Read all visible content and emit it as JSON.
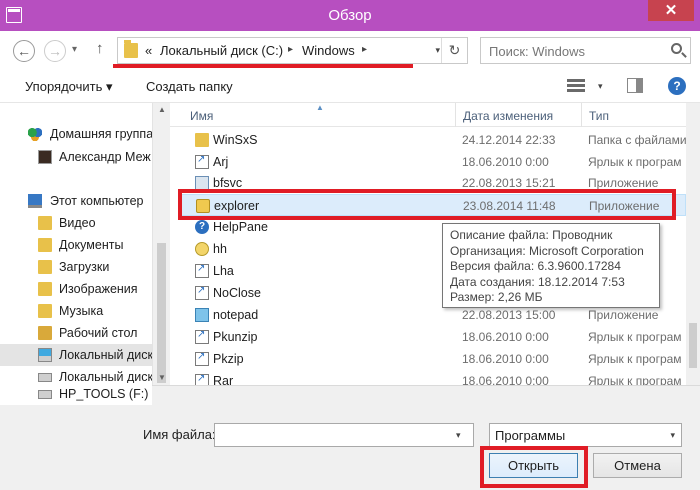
{
  "window": {
    "title": "Обзор",
    "close_glyph": "✕"
  },
  "nav": {
    "back_glyph": "←",
    "forward_glyph": "→",
    "recent_glyph": "▾",
    "up_glyph": "↑",
    "address": {
      "prefix": "«",
      "crumbs": [
        "Локальный диск (C:)",
        "Windows"
      ],
      "sep_glyph": "▸",
      "dropdown_glyph": "▾",
      "refresh_glyph": "↻"
    },
    "search": {
      "placeholder": "Поиск: Windows"
    }
  },
  "toolbar": {
    "organize_label": "Упорядочить ▾",
    "new_folder_label": "Создать папку",
    "view_dd_glyph": "▾",
    "help_glyph": "?"
  },
  "sidebar": {
    "items": [
      {
        "label": "Домашняя группа",
        "icon": "homegroup-icon"
      },
      {
        "label": "Александр Меж",
        "icon": "user-icon"
      },
      {
        "label": "Этот компьютер",
        "icon": "computer-icon"
      },
      {
        "label": "Видео",
        "icon": "folder-icon"
      },
      {
        "label": "Документы",
        "icon": "folder-icon"
      },
      {
        "label": "Загрузки",
        "icon": "folder-icon"
      },
      {
        "label": "Изображения",
        "icon": "folder-icon"
      },
      {
        "label": "Музыка",
        "icon": "folder-icon"
      },
      {
        "label": "Рабочий стол",
        "icon": "folder-icon"
      },
      {
        "label": "Локальный диск",
        "icon": "drive-icon"
      },
      {
        "label": "Локальный диск",
        "icon": "drive-icon"
      },
      {
        "label": "HP_TOOLS (F:)",
        "icon": "drive-icon"
      }
    ],
    "scroll_up_glyph": "▲",
    "scroll_down_glyph": "▼"
  },
  "columns": {
    "name": "Имя",
    "date": "Дата изменения",
    "type": "Тип",
    "sort_glyph": "▲"
  },
  "files": [
    {
      "name": "WinSxS",
      "date": "24.12.2014 22:33",
      "type": "Папка с файлами",
      "icon": "folder-icon"
    },
    {
      "name": "Arj",
      "date": "18.06.2010 0:00",
      "type": "Ярлык к програм",
      "icon": "shortcut-icon"
    },
    {
      "name": "bfsvc",
      "date": "22.08.2013 15:21",
      "type": "Приложение",
      "icon": "application-icon"
    },
    {
      "name": "explorer",
      "date": "23.08.2014 11:48",
      "type": "Приложение",
      "icon": "explorer-icon"
    },
    {
      "name": "HelpPane",
      "date": "",
      "type": "",
      "icon": "help-icon"
    },
    {
      "name": "hh",
      "date": "",
      "type": "",
      "icon": "hh-icon"
    },
    {
      "name": "Lha",
      "date": "",
      "type": "",
      "icon": "shortcut-icon"
    },
    {
      "name": "NoClose",
      "date": "",
      "type": "",
      "icon": "shortcut-icon"
    },
    {
      "name": "notepad",
      "date": "22.08.2013 15:00",
      "type": "Приложение",
      "icon": "notepad-icon"
    },
    {
      "name": "Pkunzip",
      "date": "18.06.2010 0:00",
      "type": "Ярлык к програм",
      "icon": "shortcut-icon"
    },
    {
      "name": "Pkzip",
      "date": "18.06.2010 0:00",
      "type": "Ярлык к програм",
      "icon": "shortcut-icon"
    },
    {
      "name": "Rar",
      "date": "18.06.2010 0:00",
      "type": "Ярлык к програм",
      "icon": "shortcut-icon"
    }
  ],
  "tooltip": {
    "lines": [
      "Описание файла: Проводник",
      "Организация: Microsoft Corporation",
      "Версия файла: 6.3.9600.17284",
      "Дата создания: 18.12.2014 7:53",
      "Размер: 2,26 МБ"
    ]
  },
  "footer": {
    "filename_label": "Имя файла:",
    "filename_value": "",
    "filename_dd_glyph": "▾",
    "filter_value": "Программы",
    "filter_dd_glyph": "▾",
    "open_label": "Открыть",
    "cancel_label": "Отмена"
  },
  "colors": {
    "titlebar": "#b74fc0",
    "highlight_box": "#e01c25",
    "selected_row": "#dcecfb"
  }
}
